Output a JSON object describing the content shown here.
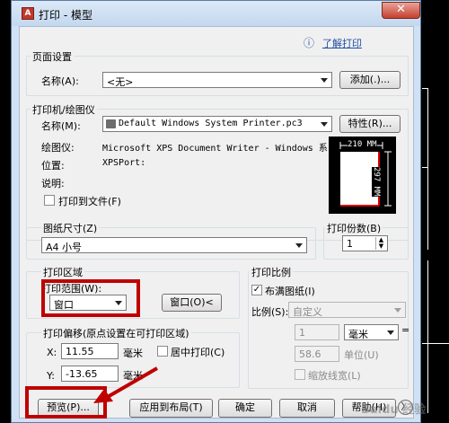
{
  "window": {
    "title": "打印 - 模型",
    "app_icon": "A",
    "close": "✕"
  },
  "help_link": {
    "icon": "ⓘ",
    "label": "了解打印"
  },
  "page_setup": {
    "group_title": "页面设置",
    "name_label": "名称(A):",
    "name_value": "<无>",
    "add_button": "添加(.)..."
  },
  "printer": {
    "group_title": "打印机/绘图仪",
    "name_label": "名称(M):",
    "name_value": "Default Windows System Printer.pc3",
    "properties_button": "特性(R)...",
    "plotter_label": "绘图仪:",
    "plotter_value": "Microsoft XPS Document Writer - Windows 系...",
    "location_label": "位置:",
    "location_value": "XPSPort:",
    "description_label": "说明:",
    "print_to_file_label": "打印到文件(F)",
    "preview_width": "210 MM",
    "preview_height": "297 MM"
  },
  "paper_size": {
    "group_title": "图纸尺寸(Z)",
    "value": "A4 小号"
  },
  "copies": {
    "group_title": "打印份数(B)",
    "value": "1"
  },
  "plot_area": {
    "group_title": "打印区域",
    "range_label": "打印范围(W):",
    "range_value": "窗口",
    "window_button": "窗口(O)<"
  },
  "plot_offset": {
    "group_title": "打印偏移(原点设置在可打印区域)",
    "x_label": "X:",
    "x_value": "11.55",
    "y_label": "Y:",
    "y_value": "-13.65",
    "x_unit": "毫米",
    "y_unit": "毫米",
    "center_label": "居中打印(C)"
  },
  "plot_scale": {
    "group_title": "打印比例",
    "fit_label": "布满图纸(I)",
    "fit_checked": true,
    "scale_label": "比例(S):",
    "scale_value": "自定义",
    "value1": "1",
    "unit_value": "毫米",
    "value2": "58.6",
    "unit_label": "单位(U)",
    "lineweight_label": "缩放线宽(L)"
  },
  "footer": {
    "preview_button": "预览(P)...",
    "apply_layout_button": "应用到布局(T)",
    "ok_button": "确定",
    "cancel_button": "取消",
    "help_button": "帮助(H)",
    "expand_icon": "〉"
  },
  "watermark": "Baidu 经验"
}
